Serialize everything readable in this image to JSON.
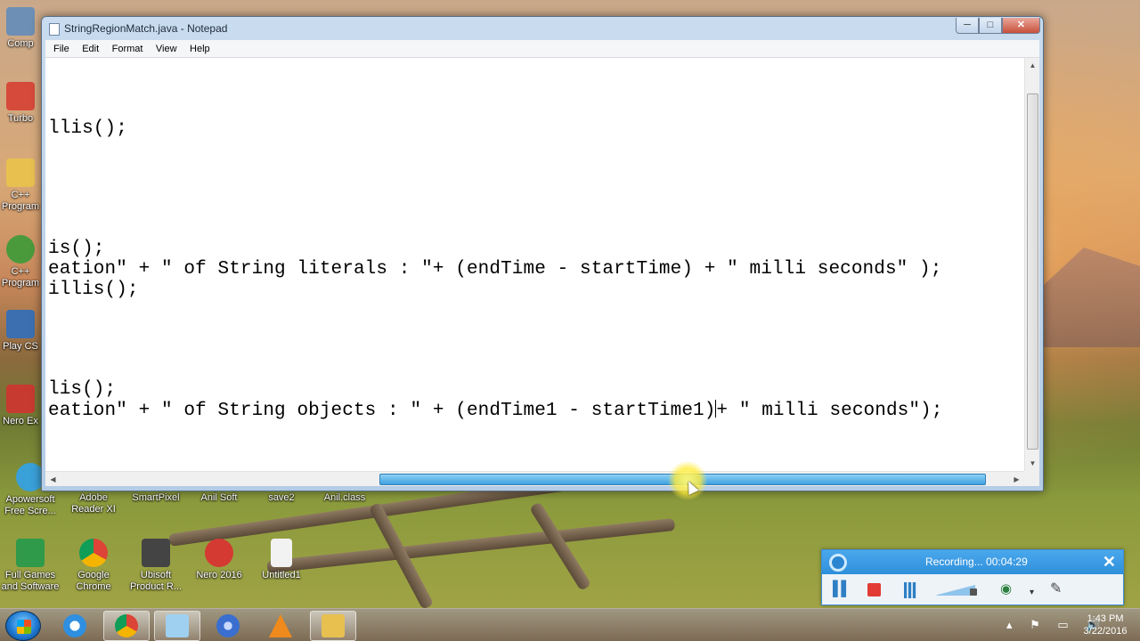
{
  "window": {
    "title": "StringRegionMatch.java - Notepad",
    "min_symbol": "─",
    "max_symbol": "□",
    "close_symbol": "✕"
  },
  "menu": [
    "File",
    "Edit",
    "Format",
    "View",
    "Help"
  ],
  "code_lines": [
    "llis();",
    "is();",
    "eation\" + \" of String literals : \"+ (endTime - startTime) + \" milli seconds\" );",
    "illis();",
    "lis();",
    "eation\" + \" of String objects : \" + (endTime1 - startTime1)",
    "+ \" milli seconds\");"
  ],
  "desktop_icons": [
    {
      "label": "Comp",
      "icon": "computer-icon",
      "color": "#6d8fb5"
    },
    {
      "label": "Turbo",
      "icon": "turbo-icon",
      "color": "#d64a3b"
    },
    {
      "label": "C++ Program",
      "icon": "folder-icon",
      "color": "#e8c050"
    },
    {
      "label": "C++ Program",
      "icon": "chrome-icon",
      "color": "#4a9a3c"
    },
    {
      "label": "Play CS",
      "icon": "shortcut-icon",
      "color": "#3b6fb0"
    },
    {
      "label": "Nero Ex",
      "icon": "nero-icon",
      "color": "#c73a30"
    },
    {
      "label": "Apowersoft Free Scre...",
      "icon": "apowersoft-icon",
      "color": "#3aa0d8"
    },
    {
      "label": "Adobe Reader XI",
      "icon": "",
      "color": ""
    },
    {
      "label": "SmartPixel",
      "icon": "",
      "color": ""
    },
    {
      "label": "Anil Soft",
      "icon": "",
      "color": ""
    },
    {
      "label": "save2",
      "icon": "",
      "color": ""
    },
    {
      "label": "Anil.class",
      "icon": "",
      "color": ""
    },
    {
      "label": "Full Games and Software",
      "icon": "games-icon",
      "color": "#2f9a4a"
    },
    {
      "label": "Google Chrome",
      "icon": "chrome-icon",
      "color": "#e0a020"
    },
    {
      "label": "Ubisoft Product R...",
      "icon": "ubisoft-icon",
      "color": "#444"
    },
    {
      "label": "Nero 2016",
      "icon": "nero-icon",
      "color": "#d43a32"
    },
    {
      "label": "Untitled1",
      "icon": "file-icon",
      "color": "#f2f2f2"
    }
  ],
  "recorder": {
    "status": "Recording... 00:04:29",
    "close_symbol": "✕",
    "pause_symbol": "▌▌",
    "camera_symbol": "◉",
    "dropdown_symbol": "▾",
    "pen_symbol": "✎"
  },
  "taskbar": {
    "apps": [
      {
        "name": "internet-explorer",
        "color": "#2f8fe0"
      },
      {
        "name": "chrome",
        "color": "#e0a020"
      },
      {
        "name": "notepad",
        "color": "#9fd0f0"
      },
      {
        "name": "browser",
        "color": "#3a6fd0"
      },
      {
        "name": "vlc",
        "color": "#f08a1c"
      },
      {
        "name": "explorer",
        "color": "#e8c050"
      }
    ],
    "tray_icons": "▴ ⚑ ▭ 🔊",
    "time": "1:43 PM",
    "date": "3/22/2016"
  }
}
